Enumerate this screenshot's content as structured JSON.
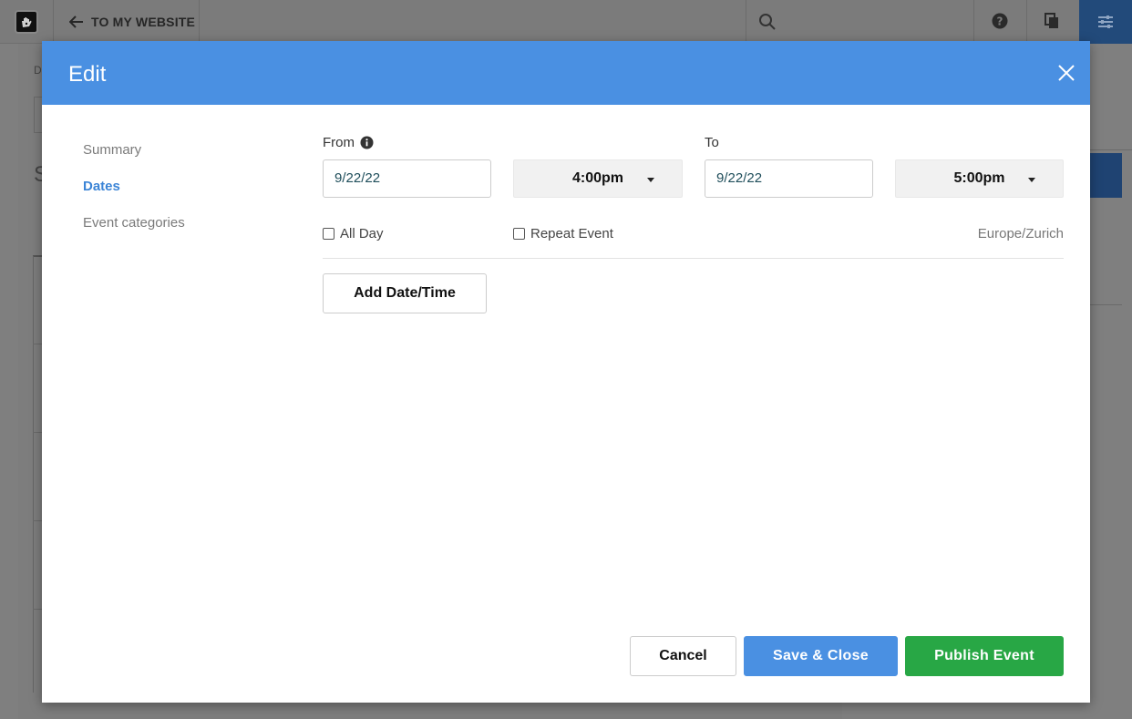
{
  "app": {
    "back_link": "TO MY WEBSITE",
    "crumb": "D",
    "section_letter": "S"
  },
  "modal": {
    "title": "Edit",
    "nav": [
      {
        "label": "Summary",
        "active": false
      },
      {
        "label": "Dates",
        "active": true
      },
      {
        "label": "Event categories",
        "active": false
      }
    ],
    "from": {
      "label": "From",
      "date": "9/22/22",
      "time": "4:00pm"
    },
    "to": {
      "label": "To",
      "date": "9/22/22",
      "time": "5:00pm"
    },
    "all_day_label": "All Day",
    "repeat_event_label": "Repeat Event",
    "timezone": "Europe/Zurich",
    "add_datetime_label": "Add Date/Time",
    "buttons": {
      "cancel": "Cancel",
      "save_close": "Save & Close",
      "publish": "Publish Event"
    }
  },
  "colors": {
    "header": "#4a90e2",
    "primary": "#4a90e2",
    "success": "#28a745",
    "active_nav": "#3b84d6"
  }
}
